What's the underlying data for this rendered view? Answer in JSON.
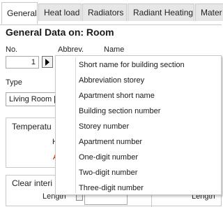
{
  "tabs": [
    {
      "label": "General"
    },
    {
      "label": "Heat load"
    },
    {
      "label": "Radiators"
    },
    {
      "label": "Radiant Heating"
    },
    {
      "label": "Mater"
    }
  ],
  "page_title": "General Data on: Room",
  "fields": {
    "no_label": "No.",
    "no_value": "1",
    "abbrev_label": "Abbrev.",
    "name_label": "Name",
    "type_label": "Type",
    "type_value": "Living Room [\\"
  },
  "groups": {
    "temperature_title": "Temperatu",
    "temperature_line1": "H",
    "temperature_line2": "A",
    "clear_title": "Clear interi",
    "clear_right_fragment": "s",
    "length_label": "Length",
    "length_label_right": "Length"
  },
  "menu": {
    "items": [
      "Short name for building section",
      "Abbreviation storey",
      "Apartment short name",
      "Building section number",
      "Storey number",
      "Apartment number",
      "One-digit number",
      "Two-digit number",
      "Three-digit number"
    ]
  },
  "colors": {
    "tab_inactive": "#e6e6e6",
    "tab_active": "#ffffff",
    "border": "#c8c8c8",
    "accent_red": "#cc0000"
  }
}
